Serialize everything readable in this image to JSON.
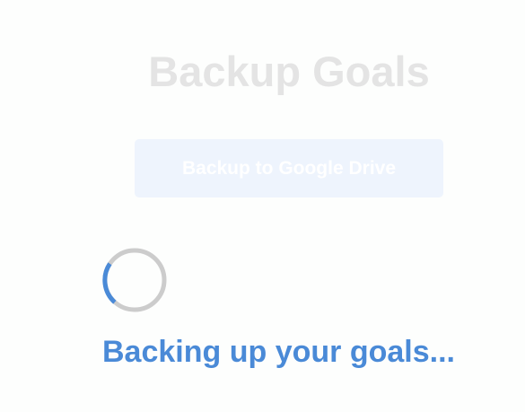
{
  "page": {
    "title": "Backup Goals"
  },
  "backup": {
    "button_label": "Backup to Google Drive",
    "status_text": "Backing up your goals...",
    "button_color": "#eef4fd",
    "accent_color": "#4a8ad7",
    "spinner_track_color": "#cccccc",
    "spinner_icon": "loading-spinner-icon"
  }
}
